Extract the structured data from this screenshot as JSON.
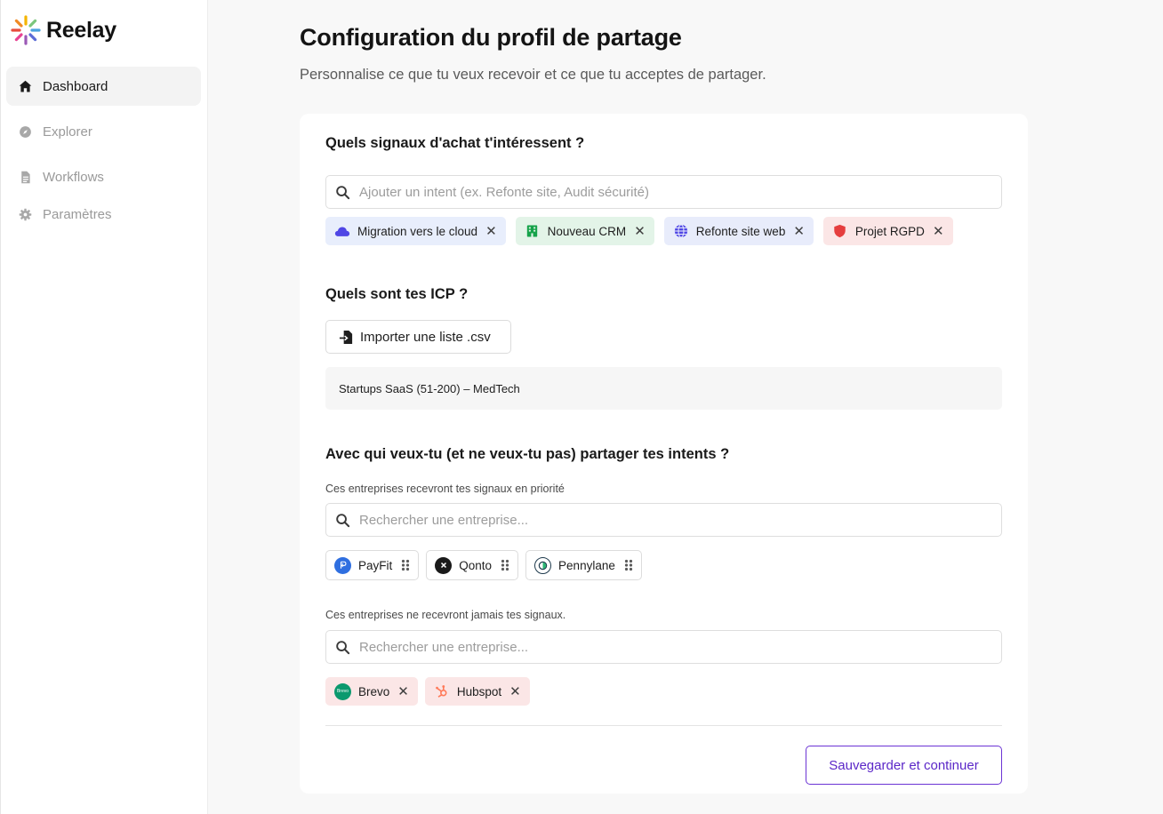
{
  "brand": {
    "name": "Reelay"
  },
  "sidebar": {
    "items": [
      {
        "label": "Dashboard",
        "icon": "home-icon",
        "active": true
      },
      {
        "label": "Explorer",
        "icon": "compass-icon",
        "active": false
      },
      {
        "label": "Workflows",
        "icon": "document-icon",
        "active": false
      },
      {
        "label": "Paramètres",
        "icon": "gear-icon",
        "active": false
      }
    ]
  },
  "page": {
    "title": "Configuration du profil de partage",
    "subtitle": "Personnalise ce que tu veux recevoir et ce que tu acceptes de partager."
  },
  "intents": {
    "title": "Quels signaux d'achat t'intéressent ?",
    "search_placeholder": "Ajouter un intent (ex. Refonte site, Audit sécurité)",
    "tags": [
      {
        "label": "Migration vers le cloud",
        "icon": "cloud-icon",
        "color": "#4f46e5"
      },
      {
        "label": "Nouveau CRM",
        "icon": "building-icon",
        "color": "#16a34a"
      },
      {
        "label": "Refonte site web",
        "icon": "globe-icon",
        "color": "#4f46e5"
      },
      {
        "label": "Projet RGPD",
        "icon": "shield-icon",
        "color": "#e53e3e"
      }
    ]
  },
  "icp": {
    "title": "Quels sont tes ICP ?",
    "import_label": "Importer une liste .csv",
    "rows": [
      "Startups SaaS (51-200) – MedTech"
    ]
  },
  "sharing": {
    "title": "Avec qui veux-tu (et ne veux-tu pas) partager tes intents ?",
    "priority_label": "Ces entreprises recevront tes signaux en priorité",
    "priority_placeholder": "Rechercher une entreprise...",
    "priority_companies": [
      {
        "name": "PayFit",
        "logo_color": "#2f6fe0"
      },
      {
        "name": "Qonto",
        "logo_color": "#1a1a1a"
      },
      {
        "name": "Pennylane",
        "logo_color": "#ffffff"
      }
    ],
    "blocked_label": "Ces entreprises ne recevront jamais tes signaux.",
    "blocked_placeholder": "Rechercher une entreprise...",
    "blocked_companies": [
      {
        "name": "Brevo",
        "logo_text": "Brevo",
        "logo_color": "#0b996e"
      },
      {
        "name": "Hubspot",
        "logo_color": "#ff7a59"
      }
    ]
  },
  "actions": {
    "save_label": "Sauvegarder et continuer"
  },
  "colors": {
    "accent": "#6b34d4",
    "active_nav_bg": "#f3f3f3"
  }
}
